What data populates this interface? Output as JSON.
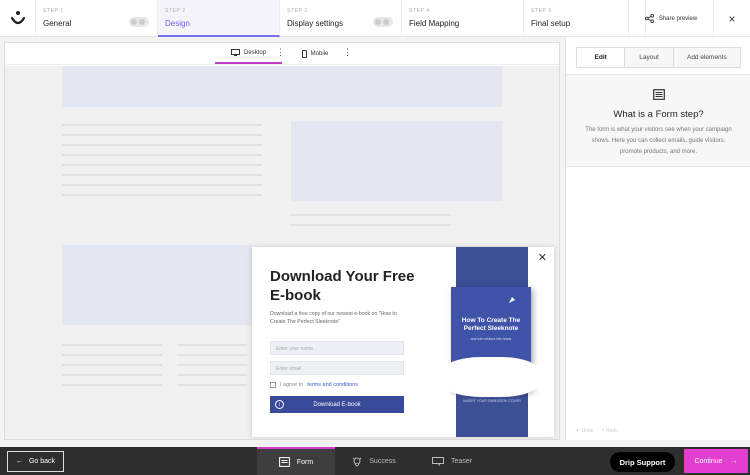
{
  "steps": [
    {
      "num": "STEP 1",
      "name": "General"
    },
    {
      "num": "STEP 2",
      "name": "Design"
    },
    {
      "num": "STEP 3",
      "name": "Display settings"
    },
    {
      "num": "STEP 4",
      "name": "Field Mapping"
    },
    {
      "num": "STEP 5",
      "name": "Final setup"
    }
  ],
  "header": {
    "share_label": "Share preview",
    "close": "×"
  },
  "viewbar": {
    "desktop": "Desktop",
    "mobile": "Mobile"
  },
  "popup": {
    "title": "Download Your Free E-book",
    "description": "Download a free copy of our newest e-book on \"How to Create The Perfect Sleeknote\".",
    "name_placeholder": "Enter your name...",
    "email_placeholder": "Enter email",
    "agree_text": "I agree to",
    "agree_link": "terms and conditions",
    "button_label": "Download E-book",
    "book_title": "How To Create The Perfect Sleeknote",
    "book_subtitle": "and turn visitors into leads",
    "cover_caption": "INSERT YOUR OWN BOOK COVER",
    "close": "✕"
  },
  "right_panel": {
    "tabs": [
      "Edit",
      "Layout",
      "Add elements"
    ],
    "info_title": "What is a Form step?",
    "info_text": "The form is what your visitors see when your campaign shows. Here you can collect emails, guide visitors, promote products, and more.",
    "undo": "Undo",
    "redo": "Redo"
  },
  "bottom": {
    "go_back": "Go back",
    "tabs": [
      "Form",
      "Success",
      "Teaser"
    ],
    "drip": "Drip Support",
    "continue": "Continue"
  },
  "colors": {
    "accent": "#6d62e8",
    "magenta": "#e23fd0",
    "button": "#3a4a9a"
  }
}
